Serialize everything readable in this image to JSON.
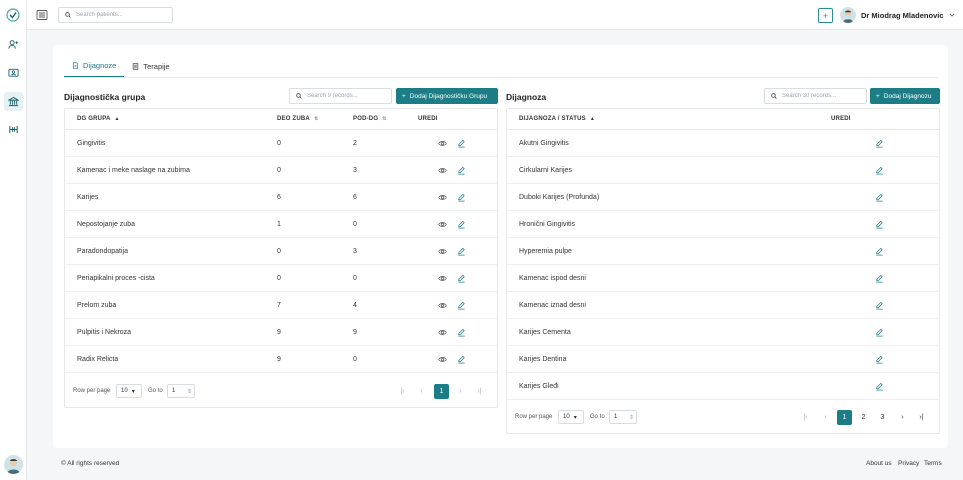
{
  "topbar": {
    "search_placeholder": "Search patients...",
    "add_label": "+",
    "user_name": "Dr Miodrag Mladenovic"
  },
  "tabs": [
    {
      "label": "Dijagnoze",
      "active": true
    },
    {
      "label": "Terapije",
      "active": false
    }
  ],
  "left_panel": {
    "title": "Dijagnostička grupa",
    "search_placeholder": "Search 9 records...",
    "add_label": "Dodaj Dijagnostičku Grupu",
    "columns": [
      "DG GRUPA",
      "DEO ZUBA",
      "POD-DG",
      "UREDI"
    ],
    "rows": [
      {
        "name": "Gingivitis",
        "deo": "0",
        "pod": "2"
      },
      {
        "name": "Kamenac i meke naslage na zubima",
        "deo": "0",
        "pod": "3"
      },
      {
        "name": "Karijes",
        "deo": "6",
        "pod": "6"
      },
      {
        "name": "Nepostojanje zuba",
        "deo": "1",
        "pod": "0"
      },
      {
        "name": "Paradondopatija",
        "deo": "0",
        "pod": "3"
      },
      {
        "name": "Periapikalni proces -cista",
        "deo": "0",
        "pod": "0"
      },
      {
        "name": "Prelom zuba",
        "deo": "7",
        "pod": "4"
      },
      {
        "name": "Pulpitis i Nekroza",
        "deo": "9",
        "pod": "9"
      },
      {
        "name": "Radix Relicta",
        "deo": "9",
        "pod": "0"
      }
    ],
    "pager": {
      "rows_label": "Row per page",
      "rows_value": "10",
      "goto_label": "Go to",
      "goto_value": "1",
      "pages": [
        "1"
      ],
      "current": "1"
    }
  },
  "right_panel": {
    "title": "Dijagnoza",
    "search_placeholder": "Search 30 records...",
    "add_label": "Dodaj Dijagnozu",
    "columns": [
      "DIJAGNOZA / STATUS",
      "UREDI"
    ],
    "rows": [
      "Akutni Gingivitis",
      "Cirkularni Karijes",
      "Duboki Karijes (Profunda)",
      "Hronični Gingivitis",
      "Hyperemia pulpe",
      "Kamenac ispod desni",
      "Kamenac iznad desni",
      "Karijes Cementa",
      "Karijes Dentina",
      "Karijes Gleđi"
    ],
    "pager": {
      "rows_label": "Row per page",
      "rows_value": "10",
      "goto_label": "Go to",
      "goto_value": "1",
      "pages": [
        "1",
        "2",
        "3"
      ],
      "current": "1"
    }
  },
  "footer": {
    "copyright": "© All rights reserved",
    "links": [
      "About us",
      "Privacy",
      "Terms"
    ]
  },
  "colors": {
    "accent": "#1d7d87"
  }
}
